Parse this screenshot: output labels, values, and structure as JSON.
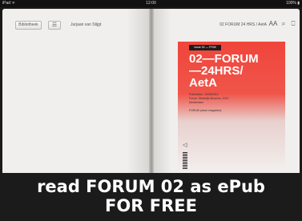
{
  "status_bar": {
    "carrier": "iPad ᯤ",
    "time": "12:00",
    "battery": "100% ▮"
  },
  "toolbar": {
    "library_label": "Bibliotheek",
    "toc_label": "☰",
    "author": "Jurjaan van Stijgt",
    "book_title": "02 FORUM 24 HRS / AetA",
    "font_size_label": "AA",
    "search_glyph": "⌕",
    "bookmark_glyph": "⎕"
  },
  "cover": {
    "tag": "Issue 02 — FR06",
    "title": "02—FORUM\n—24HRS/\nAetA",
    "info": "Publication: 10/06/2012\nForum: Stedelijk Museum, 2012\nAmsterdam\n\nFORUM (since magazine)"
  },
  "banner": {
    "line1": "read FORUM 02 as ePub",
    "line2": "FOR FREE"
  }
}
